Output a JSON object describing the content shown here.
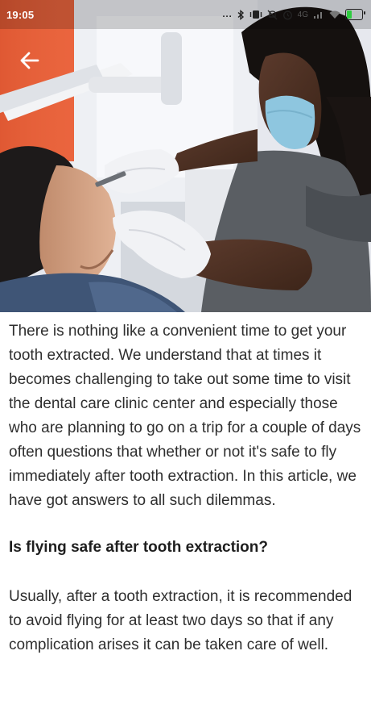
{
  "status_bar": {
    "time": "19:05",
    "overflow_dots": "...",
    "network_label": "4G",
    "icons": [
      "bluetooth-icon",
      "vibrate-icon",
      "mute-icon",
      "alarm-icon",
      "signal-icon",
      "wifi-icon",
      "battery-icon"
    ]
  },
  "header": {
    "back_icon": "arrow-left-icon"
  },
  "hero": {
    "image": "dentist-with-patient-photo",
    "colors": {
      "orange_wall": "#e8603a",
      "scrubs": "#5a5e63",
      "mask": "#8ec6df",
      "gloves": "#f1f2f5"
    }
  },
  "article": {
    "intro": "There is nothing like a convenient time to get your tooth extracted. We understand that at times it becomes challenging to take out some time to visit the dental care clinic center and especially those who are planning to go on a trip for a couple of days often questions that whether or not it's safe to fly immediately after tooth extraction. In this article, we have got answers to all such dilemmas.",
    "heading": "Is flying safe after tooth extraction?",
    "paragraph": "Usually, after a tooth extraction, it is recommended to avoid flying for at least two days so that if any complication arises it can be taken care of well."
  }
}
